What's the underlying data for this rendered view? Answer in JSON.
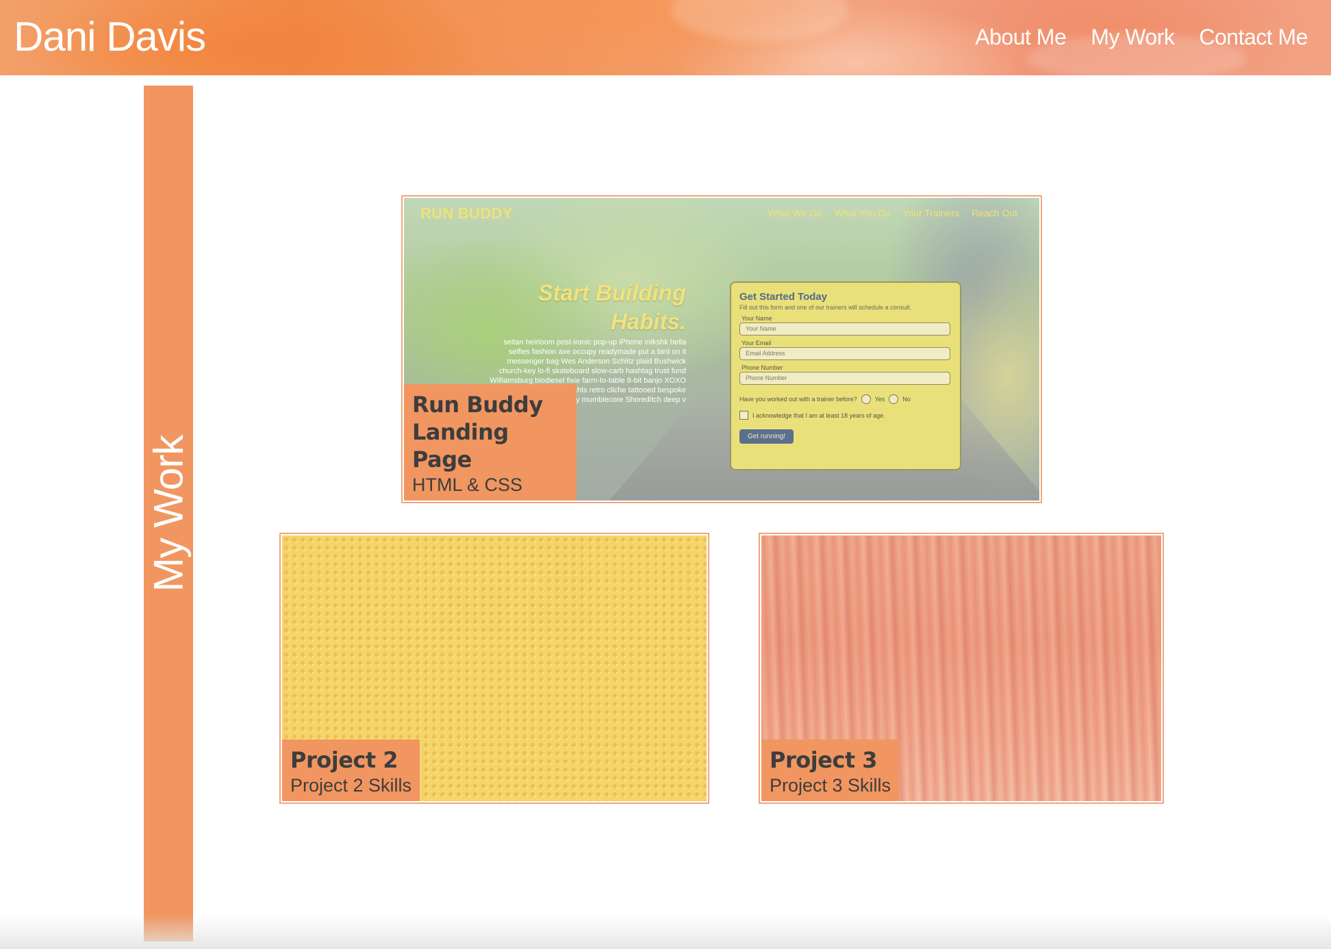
{
  "header": {
    "site_title": "Dani Davis",
    "nav": [
      {
        "label": "About Me"
      },
      {
        "label": "My Work"
      },
      {
        "label": "Contact Me"
      }
    ]
  },
  "section": {
    "heading": "My Work"
  },
  "projects": [
    {
      "title": "Run Buddy Landing Page",
      "skills": "HTML & CSS",
      "preview": {
        "logo": "RUN BUDDY",
        "nav": [
          "What We Do",
          "What You Do",
          "Your Trainers",
          "Reach Out"
        ],
        "hero_title": "Start Building Habits.",
        "hero_body": "seitan heirloom post-ironic pop-up iPhone mlkshk hella selfies fashion axe occupy readymade put a bird on it messenger bag Wes Anderson Schlitz plaid Bushwick church-key lo-fi skateboard slow-carb hashtag trust fund Williamsburg biodiesel fixie farm-to-table 8-bit banjo XOXO Banksy chillwave bicycle rights retro cliche tattooed bespoke irony mumblecore Shoreditch deep v",
        "form": {
          "title": "Get Started Today",
          "subtitle": "Fill out this form and one of our trainers will schedule a consult.",
          "name_label": "Your Name",
          "name_placeholder": "Your Name",
          "email_label": "Your Email",
          "email_placeholder": "Email Address",
          "phone_label": "Phone Number",
          "phone_placeholder": "Phone Number",
          "radio_question": "Have you worked out with a trainer before?",
          "radio_yes": "Yes",
          "radio_no": "No",
          "checkbox_label": "I acknowledge that I am at least 18 years of age.",
          "button": "Get running!"
        }
      }
    },
    {
      "title": "Project 2",
      "skills": "Project 2 Skills"
    },
    {
      "title": "Project 3",
      "skills": "Project 3 Skills"
    }
  ],
  "colors": {
    "accent": "#f19661",
    "label_text": "#3d3d3d",
    "card_border": "#f3a47a"
  }
}
